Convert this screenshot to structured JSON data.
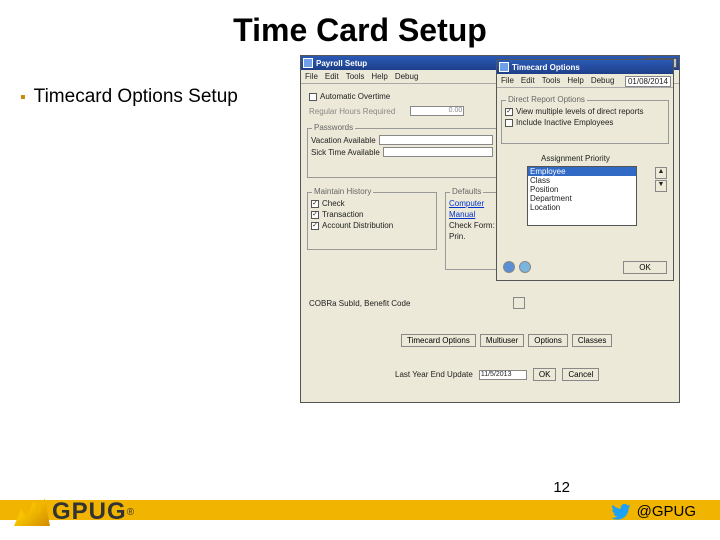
{
  "slide": {
    "title": "Time Card Setup",
    "bullet": "Timecard Options Setup"
  },
  "payroll_win": {
    "title": "Payroll Setup",
    "menu": [
      "File",
      "Edit",
      "Tools",
      "Help",
      "Debug"
    ],
    "auto_overtime": "Automatic Overtime",
    "reg_hours": "Regular Hours Required",
    "reg_hours_val": "0.00",
    "passwords": "Passwords",
    "vacation": "Vacation Available",
    "sick": "Sick Time Available",
    "history": "Maintain History",
    "chk_check": "Check",
    "chk_trans": "Transaction",
    "chk_dist": "Account Distribution",
    "defaults": "Defaults",
    "computer": "Computer",
    "manual": "Manual",
    "check_form": "Check Form:",
    "prin": "Prin.",
    "cobra": "COBRa SubId, Benefit Code",
    "btn_timecard": "Timecard Options",
    "btn_multiuser": "Multiuser",
    "btn_options": "Options",
    "btn_classes": "Classes",
    "last_update": "Last Year End Update",
    "last_update_val": "11/5/2013",
    "btn_ok": "OK",
    "btn_cancel": "Cancel"
  },
  "options_win": {
    "title": "Timecard Options",
    "menu": [
      "File",
      "Edit",
      "Tools",
      "Help",
      "Debug"
    ],
    "date": "01/08/2014",
    "section": "Direct Report Options",
    "chk_multiple": "View multiple levels of direct reports",
    "chk_inactive": "Include Inactive Employees",
    "priority": "Assignment Priority",
    "list": [
      "Employee",
      "Class",
      "Position",
      "Department",
      "Location"
    ],
    "btn_ok": "OK"
  },
  "footer": {
    "page": "12",
    "handle": "@GPUG",
    "logo": "GPUG"
  }
}
